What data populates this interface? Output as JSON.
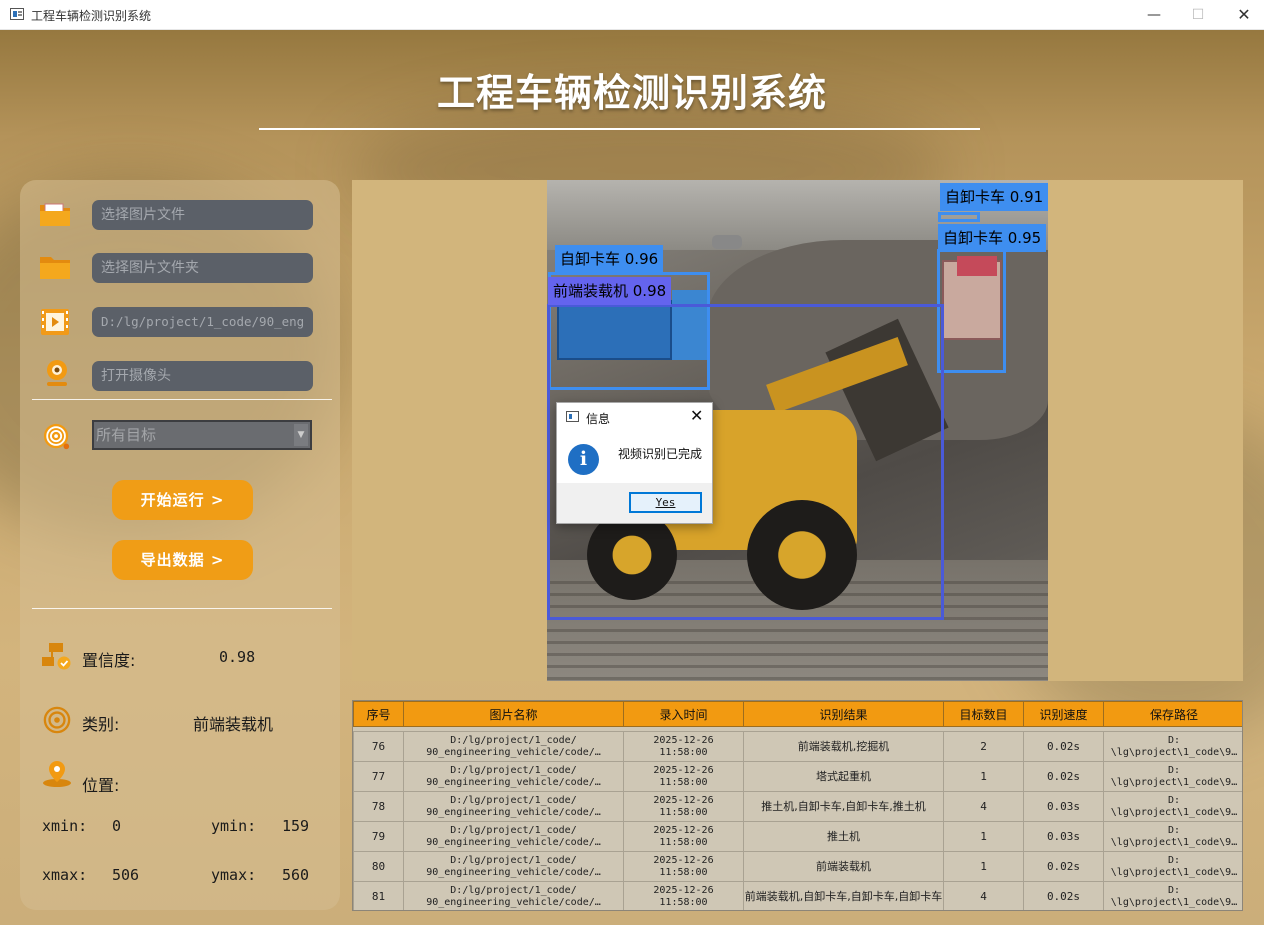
{
  "window": {
    "title": "工程车辆检测识别系统",
    "minimize": "—",
    "maximize": "☐",
    "close": "✕"
  },
  "app_title": "工程车辆检测识别系统",
  "sidebar": {
    "inputs": [
      {
        "icon": "image-folder-icon",
        "placeholder": "选择图片文件",
        "value": ""
      },
      {
        "icon": "folder-icon",
        "placeholder": "选择图片文件夹",
        "value": ""
      },
      {
        "icon": "video-file-icon",
        "placeholder": "",
        "value": "D:/lg/project/1_code/90_eng"
      },
      {
        "icon": "camera-icon",
        "placeholder": "打开摄像头",
        "value": ""
      }
    ],
    "target_select": {
      "icon": "target-icon",
      "selected": "所有目标"
    },
    "run_button": "开始运行 >",
    "export_button": "导出数据 >",
    "confidence": {
      "label": "置信度:",
      "value": "0.98"
    },
    "category": {
      "label": "类别:",
      "value": "前端装载机"
    },
    "position": {
      "label": "位置:",
      "xmin_label": "xmin:",
      "xmin": "0",
      "ymin_label": "ymin:",
      "ymin": "159",
      "xmax_label": "xmax:",
      "xmax": "506",
      "ymax_label": "ymax:",
      "ymax": "560"
    }
  },
  "detections": [
    {
      "label": "自卸卡车 0.91"
    },
    {
      "label": "自卸卡车 0.95"
    },
    {
      "label": "自卸卡车 0.96"
    },
    {
      "label": "前端装载机 0.98"
    }
  ],
  "dialog": {
    "title": "信息",
    "message": "视频识别已完成",
    "yes_button": "Yes",
    "info_glyph": "i"
  },
  "table": {
    "headers": [
      "序号",
      "图片名称",
      "录入时间",
      "识别结果",
      "目标数目",
      "识别速度",
      "保存路径"
    ],
    "rows": [
      {
        "id": "76",
        "name": "D:/lg/project/1_code/\n90_engineering_vehicle/code/…",
        "time": "2025-12-26\n11:58:00",
        "result": "前端装载机,挖掘机",
        "count": "2",
        "speed": "0.02s",
        "path": "D:\n\\lg\\project\\1_code\\9…"
      },
      {
        "id": "77",
        "name": "D:/lg/project/1_code/\n90_engineering_vehicle/code/…",
        "time": "2025-12-26\n11:58:00",
        "result": "塔式起重机",
        "count": "1",
        "speed": "0.02s",
        "path": "D:\n\\lg\\project\\1_code\\9…"
      },
      {
        "id": "78",
        "name": "D:/lg/project/1_code/\n90_engineering_vehicle/code/…",
        "time": "2025-12-26\n11:58:00",
        "result": "推土机,自卸卡车,自卸卡车,推土机",
        "count": "4",
        "speed": "0.03s",
        "path": "D:\n\\lg\\project\\1_code\\9…"
      },
      {
        "id": "79",
        "name": "D:/lg/project/1_code/\n90_engineering_vehicle/code/…",
        "time": "2025-12-26\n11:58:00",
        "result": "推土机",
        "count": "1",
        "speed": "0.03s",
        "path": "D:\n\\lg\\project\\1_code\\9…"
      },
      {
        "id": "80",
        "name": "D:/lg/project/1_code/\n90_engineering_vehicle/code/…",
        "time": "2025-12-26\n11:58:00",
        "result": "前端装载机",
        "count": "1",
        "speed": "0.02s",
        "path": "D:\n\\lg\\project\\1_code\\9…"
      },
      {
        "id": "81",
        "name": "D:/lg/project/1_code/\n90_engineering_vehicle/code/…",
        "time": "2025-12-26\n11:58:00",
        "result": "前端装载机,自卸卡车,自卸卡车,自卸卡车",
        "count": "4",
        "speed": "0.02s",
        "path": "D:\n\\lg\\project\\1_code\\9…"
      }
    ]
  },
  "colors": {
    "accent": "#f09d16",
    "input_bg": "#5b6068",
    "box_blue": "#3e8ef0",
    "box_purple": "#6464ee",
    "dialog_info": "#1f6fc4"
  }
}
